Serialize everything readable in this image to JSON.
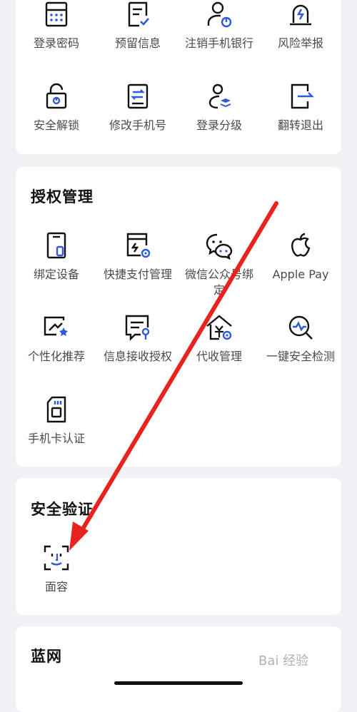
{
  "security_items_top": [
    {
      "label": "登录密码",
      "icon": "keypad-icon"
    },
    {
      "label": "预留信息",
      "icon": "note-check-icon"
    },
    {
      "label": "注销手机银行",
      "icon": "user-power-icon"
    },
    {
      "label": "风险举报",
      "icon": "alarm-icon"
    }
  ],
  "security_items_row2": [
    {
      "label": "安全解锁",
      "icon": "unlock-icon"
    },
    {
      "label": "修改手机号",
      "icon": "phone-swap-icon"
    },
    {
      "label": "登录分级",
      "icon": "user-layers-icon"
    },
    {
      "label": "翻转退出",
      "icon": "exit-icon"
    }
  ],
  "auth_section": {
    "title": "授权管理",
    "items": [
      {
        "label": "绑定设备",
        "icon": "device-bind-icon"
      },
      {
        "label": "快捷支付管理",
        "icon": "quick-pay-icon"
      },
      {
        "label": "微信公众号绑定",
        "icon": "wechat-icon"
      },
      {
        "label": "Apple Pay",
        "icon": "apple-icon"
      },
      {
        "label": "个性化推荐",
        "icon": "recommend-icon"
      },
      {
        "label": "信息接收授权",
        "icon": "message-auth-icon"
      },
      {
        "label": "代收管理",
        "icon": "collect-home-icon"
      },
      {
        "label": "一键安全检测",
        "icon": "security-scan-icon"
      },
      {
        "label": "手机卡认证",
        "icon": "sim-card-icon"
      }
    ]
  },
  "verify_section": {
    "title": "安全验证",
    "items": [
      {
        "label": "面容",
        "icon": "face-id-icon"
      }
    ]
  },
  "blue_net_section": {
    "title": "蓝网"
  },
  "watermark": "Bai 经验"
}
